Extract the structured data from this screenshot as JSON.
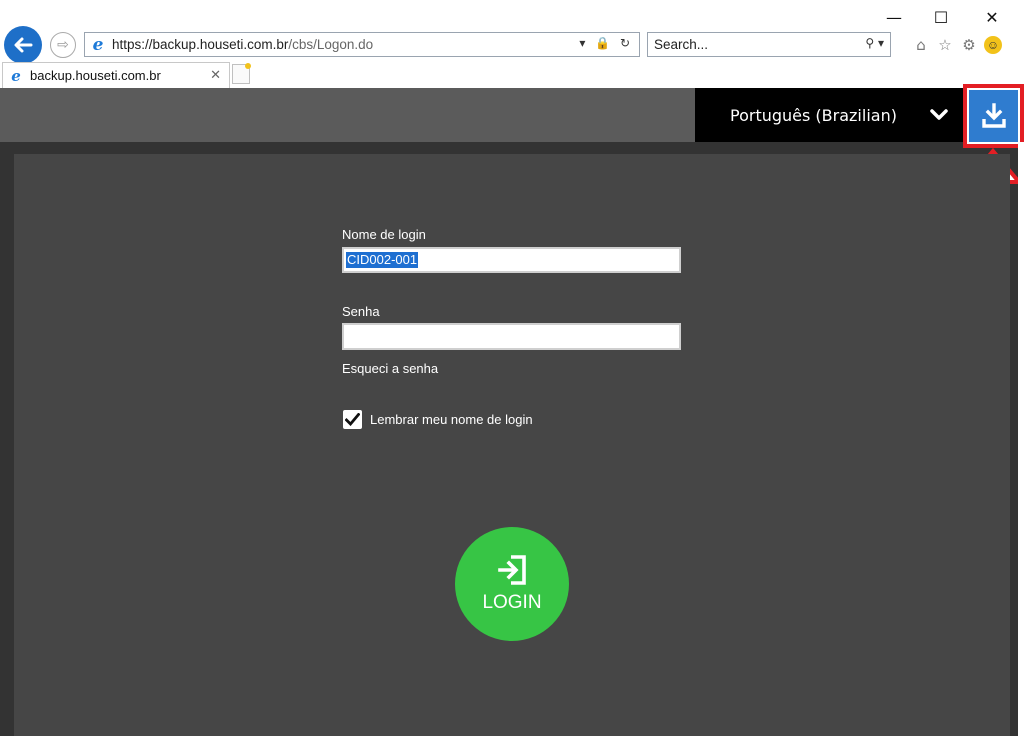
{
  "browser": {
    "url_scheme": "https://",
    "url_host": "backup.houseti.com.br",
    "url_path": "/cbs/Logon.do",
    "search_placeholder": "Search...",
    "tab_title": "backup.houseti.com.br",
    "window_controls": {
      "minimize": "—",
      "maximize": "☐",
      "close": "✕"
    }
  },
  "header": {
    "language": "Português (Brazilian)",
    "download_icon": "download-icon",
    "colors": {
      "download_bg": "#2f7ccf",
      "highlight": "#e31e24",
      "lang_bg": "#000000"
    }
  },
  "form": {
    "login_label": "Nome de login",
    "login_value": "CID002-001",
    "password_label": "Senha",
    "forgot_link": "Esqueci a senha",
    "remember_label": "Lembrar meu nome de login",
    "remember_checked": true,
    "login_button": "LOGIN",
    "login_button_color": "#37c545"
  }
}
